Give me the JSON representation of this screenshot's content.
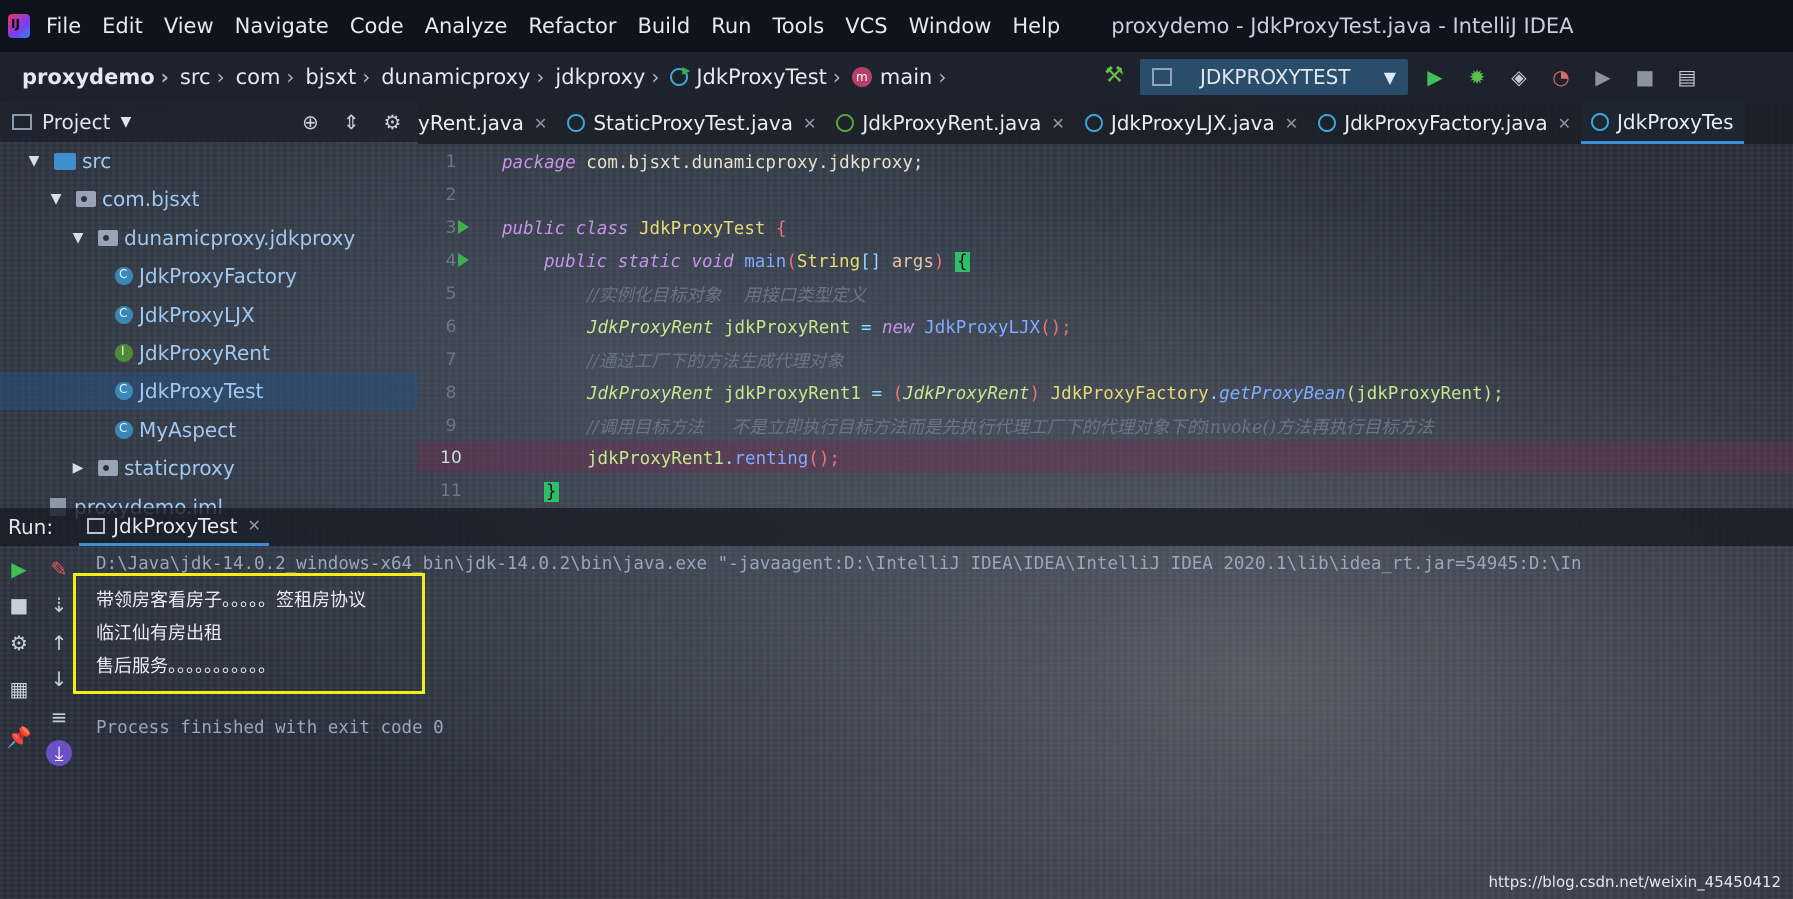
{
  "menu": {
    "items": [
      "File",
      "Edit",
      "View",
      "Navigate",
      "Code",
      "Analyze",
      "Refactor",
      "Build",
      "Run",
      "Tools",
      "VCS",
      "Window",
      "Help"
    ],
    "window_title": "proxydemo - JdkProxyTest.java - IntelliJ IDEA"
  },
  "breadcrumb": {
    "items": [
      "proxydemo",
      "src",
      "com",
      "bjsxt",
      "dunamicproxy",
      "jdkproxy",
      "JdkProxyTest",
      "main"
    ]
  },
  "toolbar": {
    "run_config": "JDKPROXYTEST"
  },
  "project": {
    "title": "Project",
    "tree": [
      {
        "label": "src",
        "kind": "src-folder",
        "depth": 1,
        "expanded": true
      },
      {
        "label": "com.bjsxt",
        "kind": "package",
        "depth": 2,
        "expanded": true
      },
      {
        "label": "dunamicproxy.jdkproxy",
        "kind": "package",
        "depth": 3,
        "expanded": true
      },
      {
        "label": "JdkProxyFactory",
        "kind": "class",
        "depth": 4
      },
      {
        "label": "JdkProxyLJX",
        "kind": "class",
        "depth": 4
      },
      {
        "label": "JdkProxyRent",
        "kind": "interface",
        "depth": 4
      },
      {
        "label": "JdkProxyTest",
        "kind": "class",
        "depth": 4,
        "selected": true
      },
      {
        "label": "MyAspect",
        "kind": "class",
        "depth": 4
      },
      {
        "label": "staticproxy",
        "kind": "package",
        "depth": 3,
        "expanded": false
      },
      {
        "label": "proxydemo.iml",
        "kind": "iml",
        "depth": 1
      }
    ]
  },
  "editor": {
    "tabs": [
      {
        "label": "yRent.java",
        "icon": "class"
      },
      {
        "label": "StaticProxyTest.java",
        "icon": "class"
      },
      {
        "label": "JdkProxyRent.java",
        "icon": "interface"
      },
      {
        "label": "JdkProxyLJX.java",
        "icon": "class"
      },
      {
        "label": "JdkProxyFactory.java",
        "icon": "class"
      },
      {
        "label": "JdkProxyTes",
        "icon": "class",
        "active": true
      }
    ],
    "line_numbers": [
      "1",
      "2",
      "3",
      "4",
      "5",
      "6",
      "7",
      "8",
      "9",
      "10",
      "11"
    ],
    "current_line": "10",
    "code": {
      "l1_kw": "package",
      "l1_rest": " com.bjsxt.dunamicproxy.jdkproxy;",
      "l3_kw": "public class",
      "l3_name": " JdkProxyTest",
      "l3_brace": " {",
      "l4_kw": "public static void",
      "l4_fn": " main",
      "l4_p1": "(",
      "l4_type": "String",
      "l4_arr": "[]",
      "l4_param": " args",
      "l4_p2": ") ",
      "l4_brace": "{",
      "l5_cmt": "//实例化目标对象    用接口类型定义",
      "l6_type": "JdkProxyRent",
      "l6_var": " jdkProxyRent",
      "l6_op": " = ",
      "l6_kw": "new",
      "l6_fn": " JdkProxyLJX",
      "l6_paren": "();",
      "l7_cmt": "//通过工厂下的方法生成代理对象",
      "l8_type": "JdkProxyRent",
      "l8_var": " jdkProxyRent1",
      "l8_op": " = ",
      "l8_cast_open": "(",
      "l8_cast_type": "JdkProxyRent",
      "l8_cast_close": ") ",
      "l8_cls": "JdkProxyFactory",
      "l8_dot": ".",
      "l8_fn": "getProxyBean",
      "l8_args": "(jdkProxyRent);",
      "l9_cmt": "//调用目标方法     不是立即执行目标方法而是先执行代理工厂下的代理对象下的invoke()方法再执行目标方法",
      "l10_var": "jdkProxyRent1",
      "l10_dot": ".",
      "l10_fn": "renting",
      "l10_end": "();",
      "l11_brace": "}"
    }
  },
  "run": {
    "label": "Run:",
    "tab": "JdkProxyTest",
    "command": "D:\\Java\\jdk-14.0.2_windows-x64_bin\\jdk-14.0.2\\bin\\java.exe \"-javaagent:D:\\IntelliJ IDEA\\IDEA\\IntelliJ IDEA 2020.1\\lib\\idea_rt.jar=54945:D:\\In",
    "output": [
      "带领房客看房子。。。。。签租房协议",
      "临江仙有房出租",
      "售后服务。。。。。。。。。。。"
    ],
    "exit": "Process finished with exit code 0"
  },
  "watermark": "https://blog.csdn.net/weixin_45450412"
}
